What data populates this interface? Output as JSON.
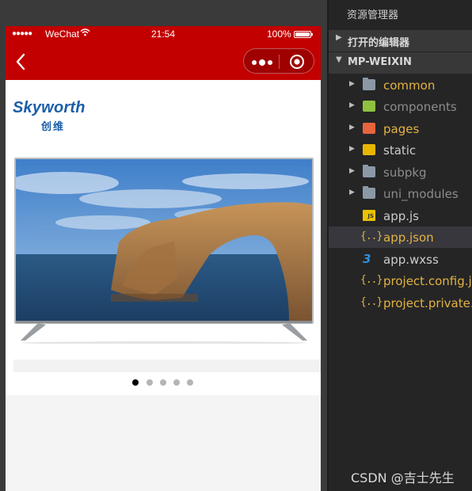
{
  "simulator": {
    "status_bar": {
      "signal": "●●●●●",
      "carrier": "WeChat",
      "time": "21:54",
      "battery_pct": "100%"
    },
    "nav": {
      "back_icon": "chevron-left-icon",
      "more_icon": "more-dots-icon",
      "close_icon": "record-circle-icon",
      "bar_color": "#c30000"
    },
    "content": {
      "brand_en": "Skyworth",
      "brand_cn": "创维",
      "brand_color": "#1a5ea8",
      "carousel": {
        "count": 5,
        "active_index": 0
      }
    }
  },
  "explorer": {
    "title": "资源管理器",
    "sections": {
      "open_editors": "打开的编辑器",
      "project": "MP-WEIXIN"
    },
    "items": [
      {
        "name": "common",
        "type": "folder",
        "color": "#e3b341"
      },
      {
        "name": "components",
        "type": "folder",
        "color": "#8c8c8c"
      },
      {
        "name": "pages",
        "type": "folder",
        "color": "#e3b341"
      },
      {
        "name": "static",
        "type": "folder",
        "color": "#cccccc"
      },
      {
        "name": "subpkg",
        "type": "folder",
        "color": "#8c8c8c"
      },
      {
        "name": "uni_modules",
        "type": "folder",
        "color": "#8c8c8c"
      },
      {
        "name": "app.js",
        "type": "js",
        "color": "#cccccc"
      },
      {
        "name": "app.json",
        "type": "json",
        "color": "#e3b341",
        "selected": true
      },
      {
        "name": "app.wxss",
        "type": "css",
        "color": "#cccccc"
      },
      {
        "name": "project.config.js",
        "type": "json",
        "color": "#e3b341"
      },
      {
        "name": "project.private.c",
        "type": "json",
        "color": "#e3b341"
      }
    ]
  },
  "watermark": "CSDN @吉士先生"
}
